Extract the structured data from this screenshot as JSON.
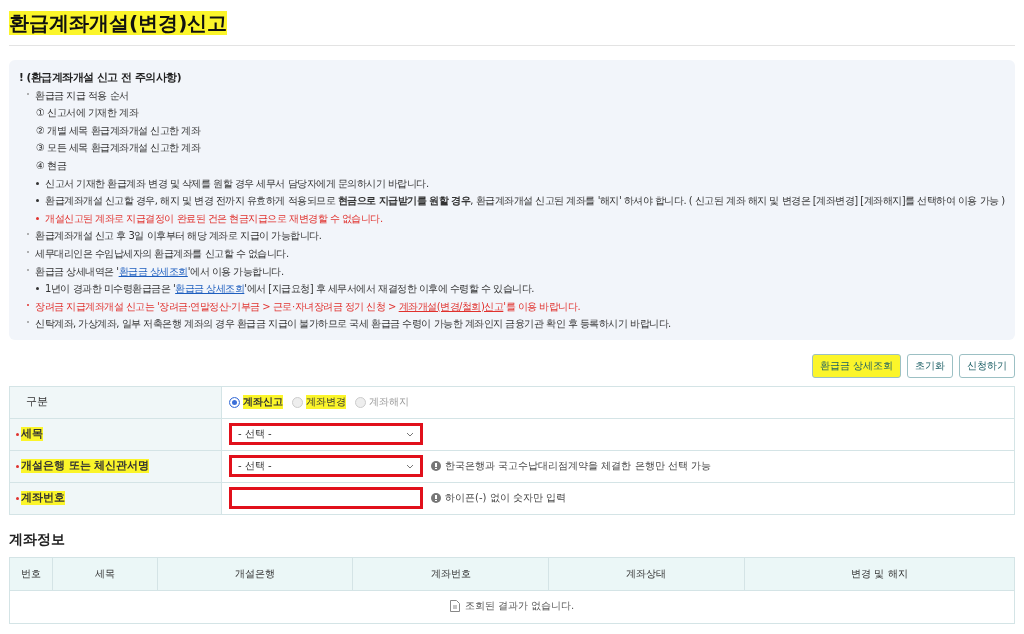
{
  "title": {
    "text": "환급계좌개설(변경)신고",
    "highlighted": true
  },
  "notice": {
    "heading": "! (환급계좌개설 신고 전 주의사항)",
    "items": [
      {
        "kind": "bullet",
        "red": false,
        "text": "환급금 지급 적용 순서"
      },
      {
        "kind": "step",
        "red": false,
        "text": "① 신고서에 기재한 계좌"
      },
      {
        "kind": "step",
        "red": false,
        "text": "② 개별 세목 환급계좌개설 신고한 계좌"
      },
      {
        "kind": "step",
        "red": false,
        "text": "③ 모든 세목 환급계좌개설 신고한 계좌"
      },
      {
        "kind": "step",
        "red": false,
        "text": "④ 현금"
      },
      {
        "kind": "sub",
        "red": false,
        "text": "신고서 기재한 환급계좌 변경 및 삭제를 원할 경우 세무서 담당자에게 문의하시기 바랍니다."
      },
      {
        "kind": "sub",
        "red": false,
        "text": "환급계좌개설 신고할 경우, 해지 및 변경 전까지 유효하게 적용되므로 **현금으로 지급받기를 원할 경우**, 환급계좌개설 신고된 계좌를 '해지' 하셔야 합니다. ( 신고된 계좌 해지 및 변경은 [계좌변경] [계좌해지]를 선택하여 이용 가능 )"
      },
      {
        "kind": "sub",
        "red": true,
        "text": "개설신고된 계좌로 지급결정이 완료된 건은 현금지급으로 재변경할 수 없습니다."
      },
      {
        "kind": "bullet",
        "red": false,
        "text": "환급계좌개설 신고 후 3일 이후부터 해당 계좌로 지급이 가능합니다."
      },
      {
        "kind": "bullet",
        "red": false,
        "text": "세무대리인은 수임납세자의 환급계좌를 신고할 수 없습니다."
      },
      {
        "kind": "bullet",
        "red": false,
        "before": "환급금 상세내역은 '",
        "link": "환급금 상세조회",
        "after": "'에서 이용 가능합니다."
      },
      {
        "kind": "sub",
        "red": false,
        "before": "1년이 경과한 미수령환급금은 '",
        "link": "환급금 상세조회",
        "after": "'에서 [지급요청] 후 세무서에서 재결정한 이후에 수령할 수 있습니다."
      },
      {
        "kind": "bullet",
        "red": true,
        "before": "장려금 지급계좌개설 신고는 '장려금·연말정산·기부금 > 근로·자녀장려금 정기 신청 > ",
        "link": "계좌개설(변경/철회)신고",
        "after": "'를 이용 바랍니다."
      },
      {
        "kind": "bullet",
        "red": false,
        "text": "신탁계좌, 가상계좌, 일부 저축은행 계좌의 경우 환급금 지급이 불가하므로 국세 환급금 수령이 가능한 계좌인지 금융기관 확인 후 등록하시기 바랍니다."
      }
    ]
  },
  "buttons": [
    {
      "label": "환급금 상세조회",
      "highlighted": true
    },
    {
      "label": "초기화",
      "highlighted": false
    },
    {
      "label": "신청하기",
      "highlighted": false
    }
  ],
  "form": [
    {
      "kind": "radio",
      "label": "구분",
      "required": false,
      "highlighted": false,
      "options": [
        {
          "label": "계좌신고",
          "selected": true,
          "highlighted": true
        },
        {
          "label": "계좌변경",
          "selected": false,
          "highlighted": true
        },
        {
          "label": "계좌해지",
          "selected": false,
          "highlighted": false
        }
      ]
    },
    {
      "kind": "select",
      "label": "세목",
      "required": true,
      "highlighted": true,
      "value": "- 선택 -",
      "outlined": true
    },
    {
      "kind": "select",
      "label": "개설은행 또는 체신관서명",
      "required": true,
      "highlighted": true,
      "value": "- 선택 -",
      "outlined": true,
      "hint": "한국은행과 국고수납대리점계약을 체결한 은행만 선택 가능"
    },
    {
      "kind": "input",
      "label": "계좌번호",
      "required": true,
      "highlighted": true,
      "outlined": true,
      "hint": "하이픈(-) 없이 숫자만 입력"
    }
  ],
  "accounts": {
    "title": "계좌정보",
    "columns": [
      "번호",
      "세목",
      "개설은행",
      "계좌번호",
      "계좌상태",
      "변경 및 해지"
    ],
    "empty": "조회된 결과가 없습니다."
  }
}
